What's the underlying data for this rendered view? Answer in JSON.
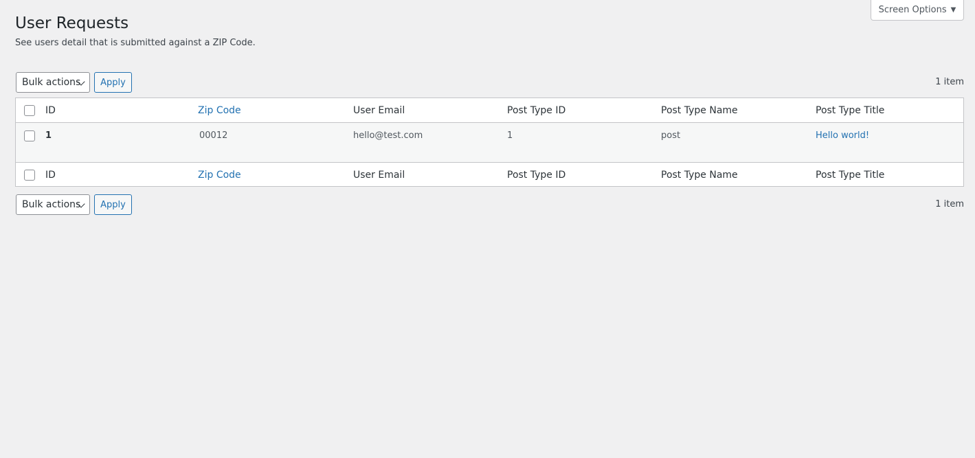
{
  "screen_options": {
    "label": "Screen Options",
    "arrow": "▼"
  },
  "page": {
    "title": "User Requests",
    "description": "See users detail that is submitted against a ZIP Code."
  },
  "tablenav": {
    "bulk_actions": "Bulk actions",
    "apply": "Apply",
    "count": "1 item"
  },
  "table": {
    "columns": [
      "ID",
      "Zip Code",
      "User Email",
      "Post Type ID",
      "Post Type Name",
      "Post Type Title"
    ],
    "rows": [
      {
        "id": "1",
        "zip": "00012",
        "email": "hello@test.com",
        "post_type_id": "1",
        "post_type_name": "post",
        "post_type_title": "Hello world!"
      }
    ]
  },
  "colors": {
    "link": "#2271b1",
    "background": "#f0f0f1",
    "border": "#c3c4c7"
  }
}
